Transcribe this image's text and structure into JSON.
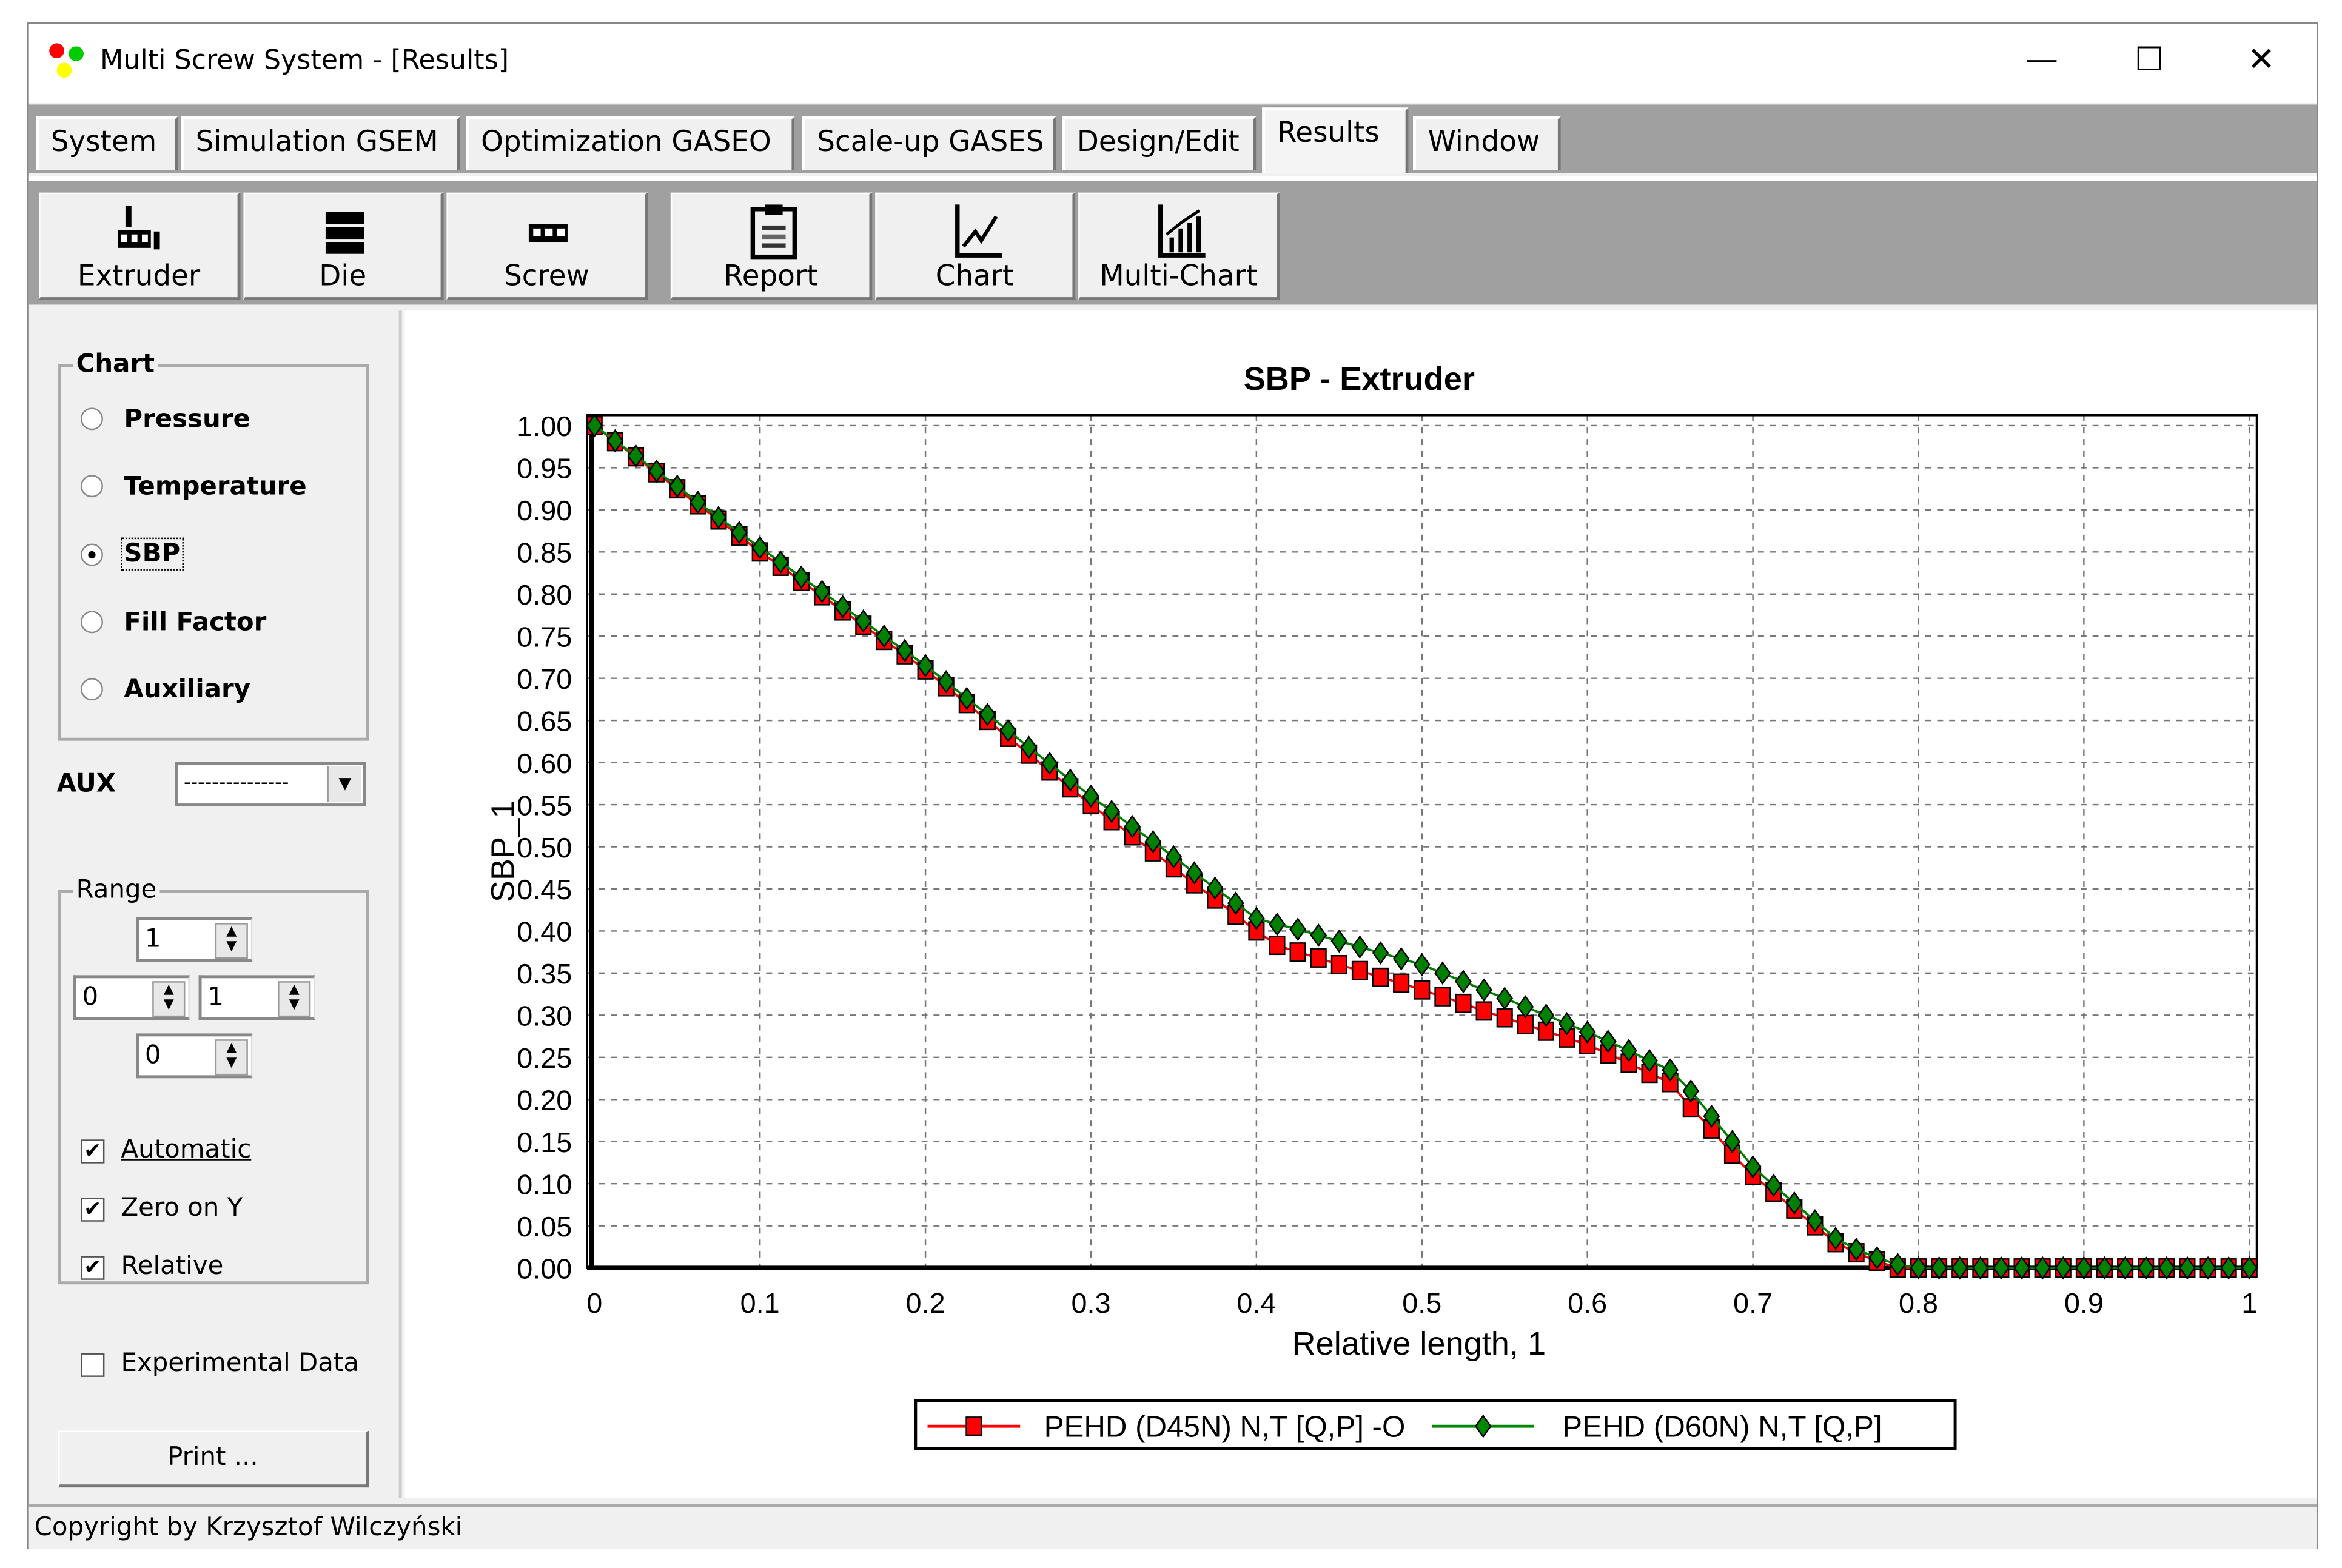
{
  "window": {
    "title": "Multi Screw System - [Results]",
    "controls": {
      "minimize": "—",
      "maximize": "☐",
      "close": "✕"
    }
  },
  "menu": {
    "tabs": [
      {
        "label": "System"
      },
      {
        "label": "Simulation GSEM"
      },
      {
        "label": "Optimization GASEO"
      },
      {
        "label": "Scale-up GASES"
      },
      {
        "label": "Design/Edit"
      },
      {
        "label": "Results",
        "active": true
      },
      {
        "label": "Window"
      }
    ]
  },
  "toolbar": {
    "buttons": [
      {
        "label": "Extruder",
        "icon": "extruder-icon"
      },
      {
        "label": "Die",
        "icon": "die-icon"
      },
      {
        "label": "Screw",
        "icon": "screw-icon"
      },
      {
        "label": "Report",
        "icon": "clipboard-icon"
      },
      {
        "label": "Chart",
        "icon": "line-chart-icon"
      },
      {
        "label": "Multi-Chart",
        "icon": "multi-chart-icon"
      }
    ]
  },
  "left_panel": {
    "chart_group": {
      "title": "Chart",
      "options": [
        {
          "label": "Pressure",
          "selected": false
        },
        {
          "label": "Temperature",
          "selected": false
        },
        {
          "label": "SBP",
          "selected": true
        },
        {
          "label": "Fill Factor",
          "selected": false
        },
        {
          "label": "Auxiliary",
          "selected": false
        }
      ]
    },
    "aux": {
      "label": "AUX",
      "value": "---------------"
    },
    "range_group": {
      "title": "Range",
      "top": "1",
      "left": "0",
      "right": "1",
      "bottom": "0",
      "checkboxes": [
        {
          "label": "Automatic",
          "checked": true
        },
        {
          "label": "Zero on Y",
          "checked": true
        },
        {
          "label": "Relative",
          "checked": true
        }
      ]
    },
    "experimental": {
      "label": "Experimental Data",
      "checked": false
    },
    "print_label": "Print ..."
  },
  "status_bar": {
    "text": "Copyright by Krzysztof Wilczyński"
  },
  "chart_data": {
    "type": "line",
    "title": "SBP - Extruder",
    "xlabel": "Relative length, 1",
    "ylabel": "SBP_1",
    "xlim": [
      0,
      1
    ],
    "ylim": [
      0,
      1
    ],
    "grid": true,
    "legend_placement": "bottom",
    "xticks": [
      "0",
      "0.1",
      "0.2",
      "0.3",
      "0.4",
      "0.5",
      "0.6",
      "0.7",
      "0.8",
      "0.9",
      "1"
    ],
    "yticks": [
      "0.00",
      "0.05",
      "0.10",
      "0.15",
      "0.20",
      "0.25",
      "0.30",
      "0.35",
      "0.40",
      "0.45",
      "0.50",
      "0.55",
      "0.60",
      "0.65",
      "0.70",
      "0.75",
      "0.80",
      "0.85",
      "0.90",
      "0.95",
      "1.00"
    ],
    "x_start": 0,
    "x_step": 0.0125,
    "series": [
      {
        "name": "PEHD (D45N) N,T [Q,P] -O",
        "color": "#ff0000",
        "marker": "square",
        "marker_color": "#ff0000",
        "values": [
          1.0,
          0.981,
          0.963,
          0.944,
          0.925,
          0.906,
          0.888,
          0.869,
          0.85,
          0.833,
          0.815,
          0.798,
          0.78,
          0.763,
          0.745,
          0.728,
          0.71,
          0.69,
          0.67,
          0.65,
          0.63,
          0.61,
          0.59,
          0.57,
          0.55,
          0.531,
          0.513,
          0.494,
          0.475,
          0.456,
          0.438,
          0.419,
          0.4,
          0.383,
          0.375,
          0.368,
          0.36,
          0.353,
          0.345,
          0.338,
          0.33,
          0.322,
          0.314,
          0.305,
          0.297,
          0.289,
          0.281,
          0.273,
          0.265,
          0.254,
          0.243,
          0.231,
          0.22,
          0.19,
          0.165,
          0.135,
          0.11,
          0.09,
          0.07,
          0.05,
          0.03,
          0.018,
          0.008,
          0,
          0,
          0,
          0,
          0,
          0,
          0,
          0,
          0,
          0,
          0,
          0,
          0,
          0,
          0,
          0,
          0,
          0
        ]
      },
      {
        "name": "PEHD (D60N) N,T [Q,P]",
        "color": "#008000",
        "marker": "diamond",
        "marker_color": "#008000",
        "values": [
          1.0,
          0.982,
          0.964,
          0.946,
          0.928,
          0.909,
          0.891,
          0.873,
          0.855,
          0.838,
          0.82,
          0.803,
          0.785,
          0.768,
          0.75,
          0.733,
          0.715,
          0.696,
          0.676,
          0.657,
          0.638,
          0.618,
          0.599,
          0.579,
          0.56,
          0.542,
          0.524,
          0.506,
          0.488,
          0.469,
          0.451,
          0.433,
          0.415,
          0.408,
          0.402,
          0.395,
          0.388,
          0.381,
          0.374,
          0.367,
          0.36,
          0.35,
          0.34,
          0.33,
          0.32,
          0.31,
          0.3,
          0.29,
          0.28,
          0.269,
          0.258,
          0.246,
          0.235,
          0.21,
          0.18,
          0.15,
          0.12,
          0.098,
          0.077,
          0.056,
          0.035,
          0.022,
          0.012,
          0.004,
          0,
          0,
          0,
          0,
          0,
          0,
          0,
          0,
          0,
          0,
          0,
          0,
          0,
          0,
          0,
          0,
          0
        ]
      }
    ]
  }
}
